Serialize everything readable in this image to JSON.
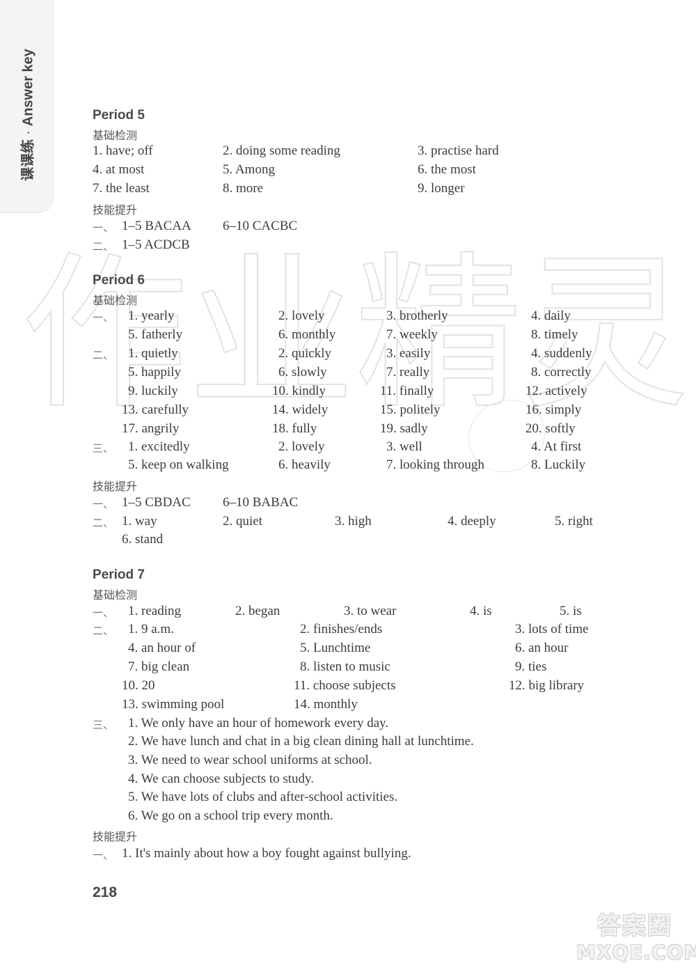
{
  "side_tab": {
    "cn": "课课练",
    "sep": "·",
    "en": "Answer key"
  },
  "watermark": [
    "作",
    "业",
    "精",
    "灵"
  ],
  "labels": {
    "basic": "基础检测",
    "skill": "技能提升",
    "one": "一、",
    "two": "二、",
    "three": "三、"
  },
  "period5": {
    "title": "Period 5",
    "basic": [
      "1. have; off",
      "2. doing some reading",
      "3. practise hard",
      "4. at most",
      "5. Among",
      "6. the most",
      "7. the least",
      "8. more",
      "9. longer"
    ],
    "skill": {
      "one": [
        "1–5 BACAA",
        "6–10 CACBC"
      ],
      "two": [
        "1–5 ACDCB"
      ]
    }
  },
  "period6": {
    "title": "Period 6",
    "basic_one": [
      "1. yearly",
      "2. lovely",
      "3. brotherly",
      "4. daily",
      "5. fatherly",
      "6. monthly",
      "7. weekly",
      "8. timely"
    ],
    "basic_two": [
      "1. quietly",
      "2. quickly",
      "3. easily",
      "4. suddenly",
      "5. happily",
      "6. slowly",
      "7. really",
      "8. correctly",
      "9. luckily",
      "10. kindly",
      "11. finally",
      "12. actively",
      "13. carefully",
      "14. widely",
      "15. politely",
      "16. simply",
      "17. angrily",
      "18. fully",
      "19. sadly",
      "20. softly"
    ],
    "basic_three": [
      "1. excitedly",
      "2. lovely",
      "3. well",
      "4. At first",
      "5. keep on walking",
      "6. heavily",
      "7. looking through",
      "8. Luckily"
    ],
    "skill": {
      "one": [
        "1–5  CBDAC",
        "6–10  BABAC"
      ],
      "two": [
        "1. way",
        "2. quiet",
        "3. high",
        "4. deeply",
        "5. right",
        "6. stand"
      ]
    }
  },
  "period7": {
    "title": "Period 7",
    "basic_one": [
      "1. reading",
      "2. began",
      "3. to wear",
      "4. is",
      "5. is"
    ],
    "basic_two": [
      "1. 9 a.m.",
      "2. finishes/ends",
      "3. lots of time",
      "4. an hour of",
      "5. Lunchtime",
      "6. an hour",
      "7. big clean",
      "8. listen to music",
      "9. ties",
      "10. 20",
      "11. choose subjects",
      "12. big library",
      "13. swimming pool",
      "14. monthly"
    ],
    "basic_three": [
      "1. We only have an hour of homework every day.",
      "2. We have lunch and chat in a big clean dining hall at lunchtime.",
      "3. We need to wear school uniforms at school.",
      "4. We can choose subjects to study.",
      "5. We have lots of clubs and after-school activities.",
      "6. We go on a school trip every month."
    ],
    "skill": {
      "one": [
        "1. It's mainly about how a boy fought against bullying."
      ]
    }
  },
  "page_number": "218",
  "site_logo": {
    "line1": "答案圈",
    "line2": "MXQE.COM"
  }
}
